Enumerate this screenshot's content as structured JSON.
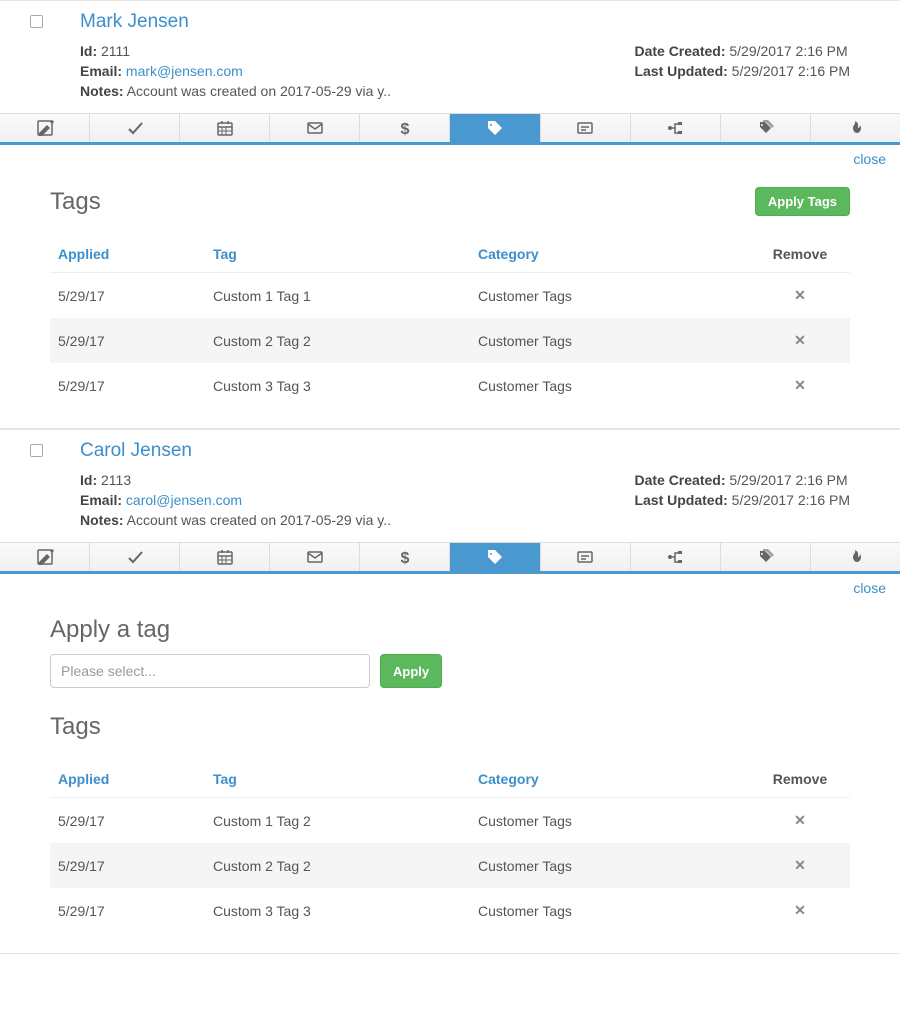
{
  "labels": {
    "id": "Id:",
    "email": "Email:",
    "notes": "Notes:",
    "date_created": "Date Created:",
    "last_updated": "Last Updated:",
    "close": "close",
    "tags_heading": "Tags",
    "apply_tags_btn": "Apply Tags",
    "apply_btn": "Apply",
    "apply_tag_heading": "Apply a tag",
    "select_placeholder": "Please select...",
    "col_applied": "Applied",
    "col_tag": "Tag",
    "col_category": "Category",
    "col_remove": "Remove"
  },
  "records": [
    {
      "name": "Mark Jensen",
      "id": "2111",
      "email": "mark@jensen.com",
      "notes": "Account was created on 2017-05-29 via y..",
      "date_created": "5/29/2017 2:16 PM",
      "last_updated": "5/29/2017 2:16 PM",
      "show_apply_form": false,
      "tags": [
        {
          "applied": "5/29/17",
          "tag": "Custom 1 Tag 1",
          "category": "Customer Tags"
        },
        {
          "applied": "5/29/17",
          "tag": "Custom 2 Tag 2",
          "category": "Customer Tags"
        },
        {
          "applied": "5/29/17",
          "tag": "Custom 3 Tag 3",
          "category": "Customer Tags"
        }
      ]
    },
    {
      "name": "Carol Jensen",
      "id": "2113",
      "email": "carol@jensen.com",
      "notes": "Account was created on 2017-05-29 via y..",
      "date_created": "5/29/2017 2:16 PM",
      "last_updated": "5/29/2017 2:16 PM",
      "show_apply_form": true,
      "tags": [
        {
          "applied": "5/29/17",
          "tag": "Custom 1 Tag 2",
          "category": "Customer Tags"
        },
        {
          "applied": "5/29/17",
          "tag": "Custom 2 Tag 2",
          "category": "Customer Tags"
        },
        {
          "applied": "5/29/17",
          "tag": "Custom 3 Tag 3",
          "category": "Customer Tags"
        }
      ]
    }
  ]
}
